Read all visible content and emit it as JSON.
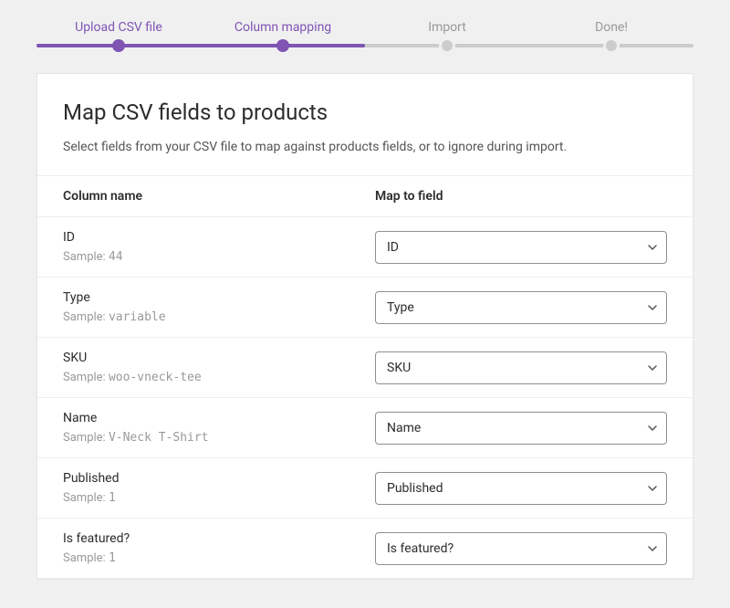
{
  "progress": {
    "steps": [
      {
        "label": "Upload CSV file",
        "state": "completed"
      },
      {
        "label": "Column mapping",
        "state": "active"
      },
      {
        "label": "Import",
        "state": "pending"
      },
      {
        "label": "Done!",
        "state": "pending"
      }
    ]
  },
  "header": {
    "title": "Map CSV fields to products",
    "description": "Select fields from your CSV file to map against products fields, or to ignore during import."
  },
  "table": {
    "columns": {
      "name": "Column name",
      "field": "Map to field"
    },
    "sample_prefix": "Sample:",
    "rows": [
      {
        "name": "ID",
        "sample": "44",
        "selected": "ID"
      },
      {
        "name": "Type",
        "sample": "variable",
        "selected": "Type"
      },
      {
        "name": "SKU",
        "sample": "woo-vneck-tee",
        "selected": "SKU"
      },
      {
        "name": "Name",
        "sample": "V-Neck T-Shirt",
        "selected": "Name"
      },
      {
        "name": "Published",
        "sample": "1",
        "selected": "Published"
      },
      {
        "name": "Is featured?",
        "sample": "1",
        "selected": "Is featured?"
      }
    ]
  }
}
